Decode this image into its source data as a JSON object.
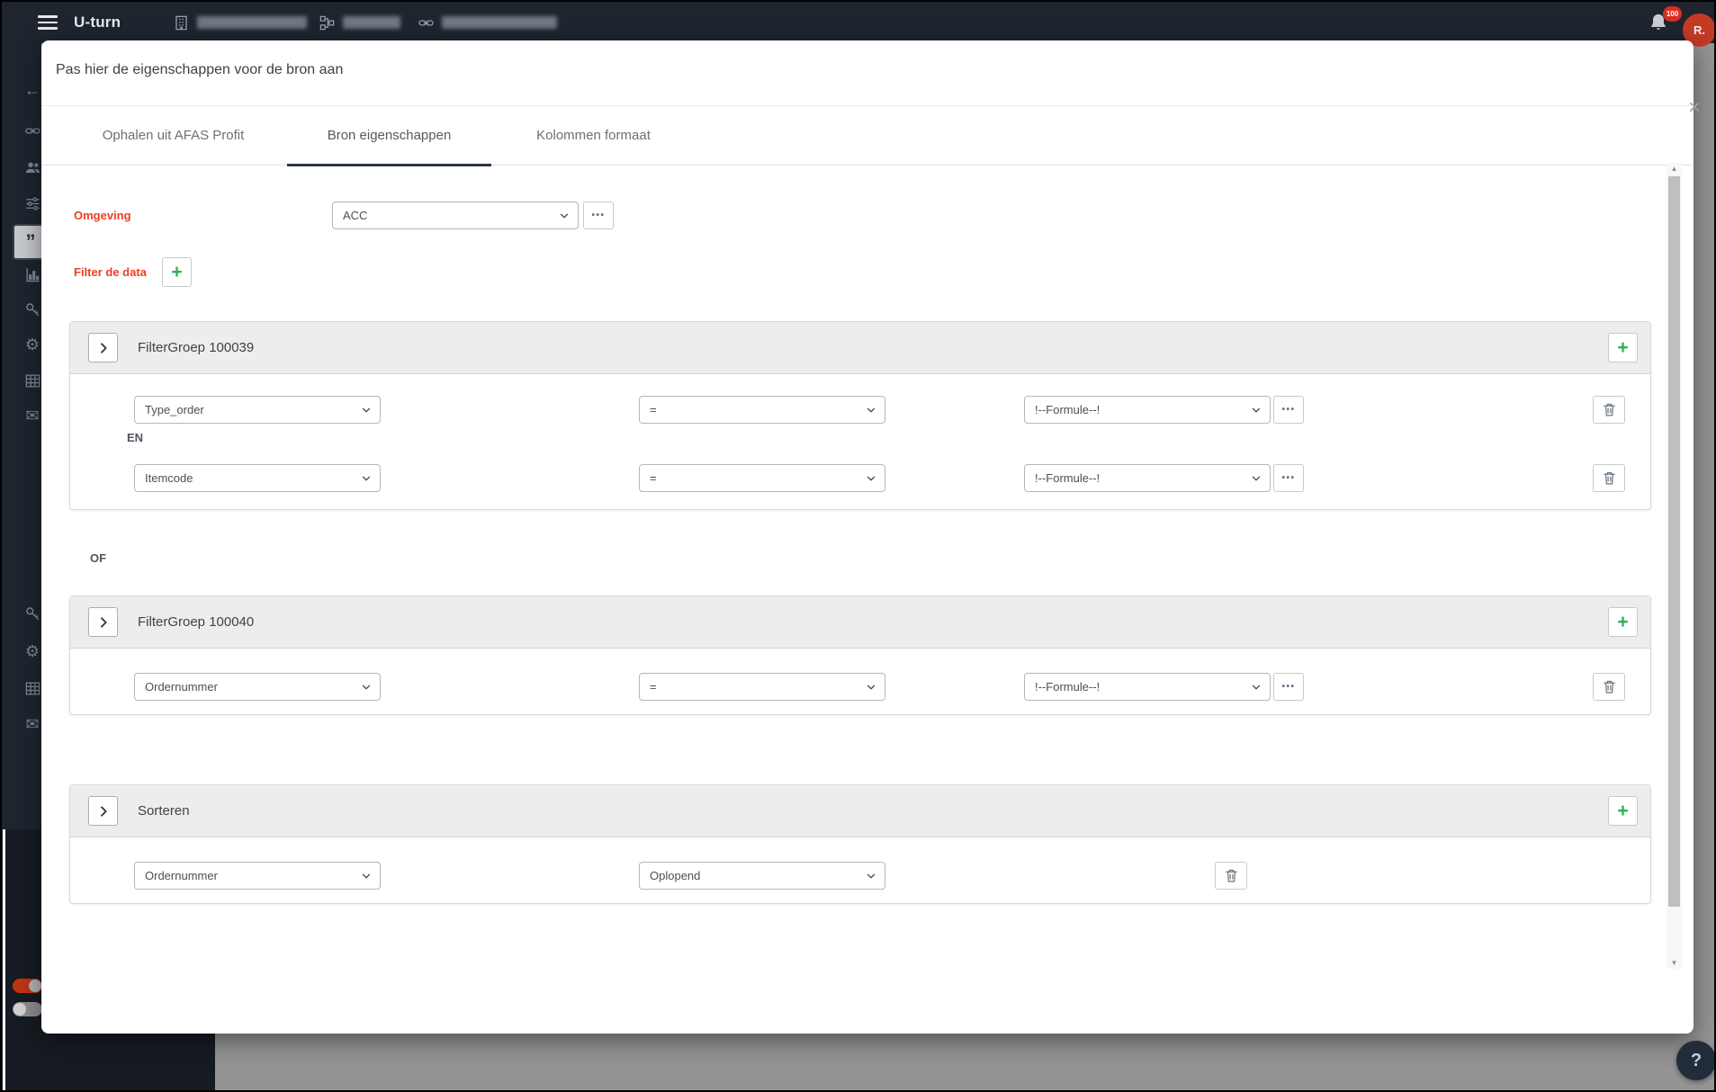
{
  "topbar": {
    "app_title": "U-turn",
    "notification_count": "100",
    "avatar_initials": "R."
  },
  "modal": {
    "title": "Pas hier de eigenschappen voor de bron aan",
    "tabs": [
      {
        "label": "Ophalen uit AFAS Profit",
        "active": false
      },
      {
        "label": "Bron eigenschappen",
        "active": true
      },
      {
        "label": "Kolommen formaat",
        "active": false
      }
    ],
    "omgeving": {
      "label": "Omgeving",
      "value": "ACC"
    },
    "filter": {
      "label": "Filter de data"
    },
    "groups": [
      {
        "title": "FilterGroep 100039",
        "row_connector": "EN",
        "rows": [
          {
            "field": "Type_order",
            "operator": "=",
            "value": "!--Formule--!"
          },
          {
            "field": "Itemcode",
            "operator": "=",
            "value": "!--Formule--!"
          }
        ]
      },
      {
        "title": "FilterGroep 100040",
        "rows": [
          {
            "field": "Ordernummer",
            "operator": "=",
            "value": "!--Formule--!"
          }
        ]
      }
    ],
    "group_connector": "OF",
    "sort": {
      "title": "Sorteren",
      "rows": [
        {
          "field": "Ordernummer",
          "direction": "Oplopend"
        }
      ]
    }
  },
  "icons": {
    "close": "×",
    "plus": "+",
    "dots": "•••",
    "arrow_left": "←",
    "gear": "⚙",
    "envelope": "✉",
    "quote": "”",
    "question": "?",
    "scroll_up": "▲",
    "scroll_down": "▼"
  },
  "colors": {
    "accent_red": "#ee3d23",
    "accent_green": "#2eb050",
    "topbar_bg": "#1e252f"
  }
}
